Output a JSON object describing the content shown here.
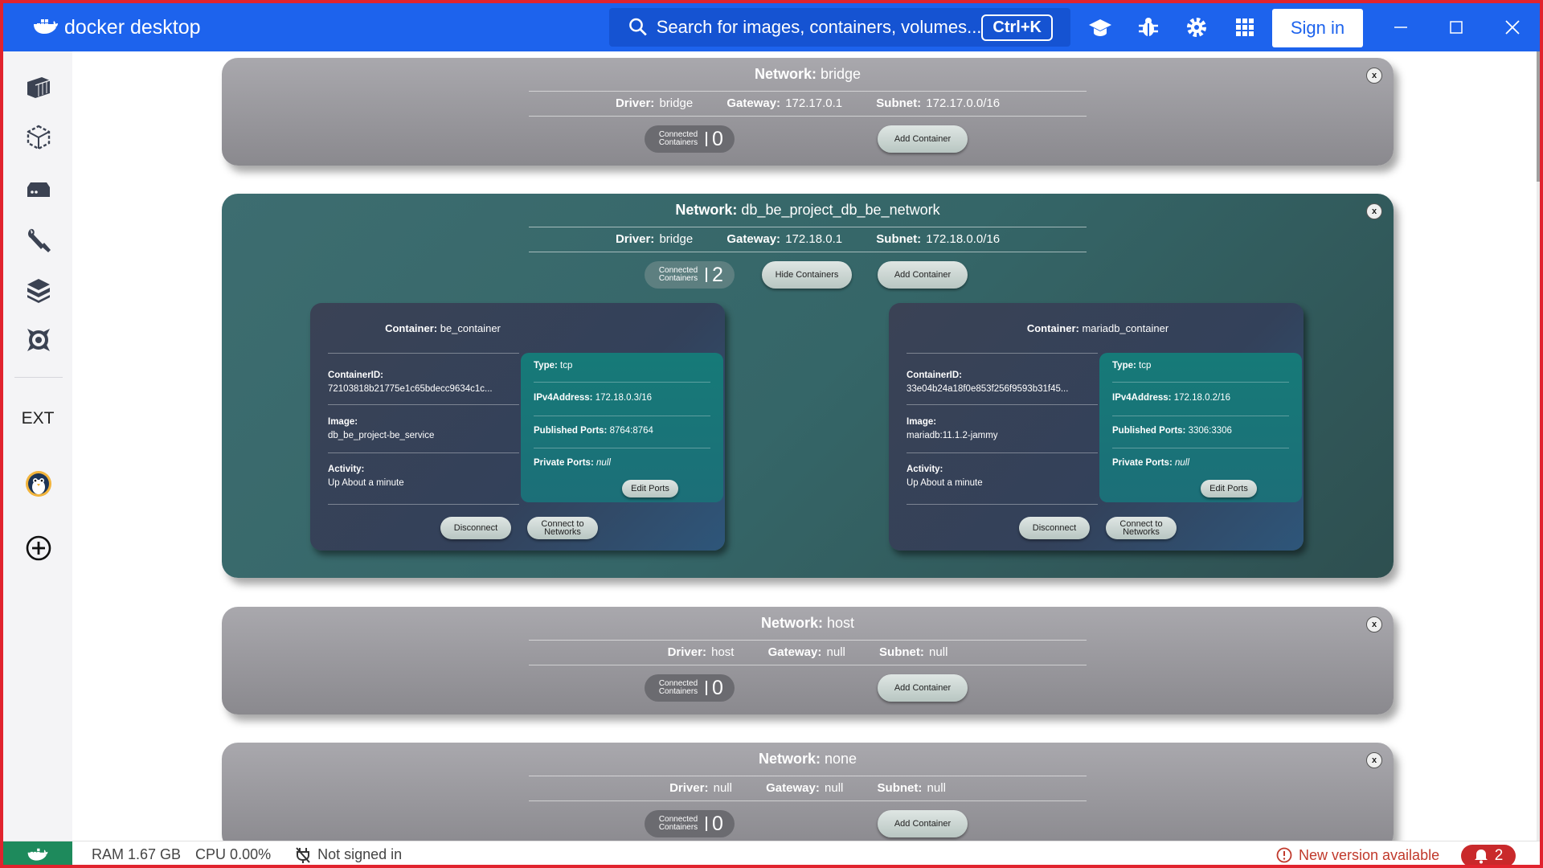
{
  "app": {
    "logo_text": "docker desktop",
    "sign_in_label": "Sign in"
  },
  "search": {
    "placeholder": "Search for images, containers, volumes...",
    "shortcut": "Ctrl+K"
  },
  "sidebar": {
    "ext_label": "EXT",
    "icons": [
      "containers-icon",
      "images-icon",
      "volumes-icon",
      "dev-tools-icon",
      "builds-icon",
      "scout-icon",
      "extension-avatar-icon",
      "add-extension-icon"
    ]
  },
  "networks": [
    {
      "name": "bridge",
      "driver": "bridge",
      "gateway": "172.17.0.1",
      "subnet": "172.17.0.0/16",
      "connected_count": "0"
    },
    {
      "name": "db_be_project_db_be_network",
      "driver": "bridge",
      "gateway": "172.18.0.1",
      "subnet": "172.18.0.0/16",
      "connected_count": "2",
      "hide_label": "Hide Containers",
      "containers": [
        {
          "name": "be_container",
          "container_id": "72103818b21775e1c65bdecc9634c1c...",
          "image": "db_be_project-be_service",
          "activity": "Up About a minute",
          "type": "tcp",
          "ipv4": "172.18.0.3/16",
          "published_ports": "8764:8764",
          "private_ports": "null"
        },
        {
          "name": "mariadb_container",
          "container_id": "33e04b24a18f0e853f256f9593b31f45...",
          "image": "mariadb:11.1.2-jammy",
          "activity": "Up About a minute",
          "type": "tcp",
          "ipv4": "172.18.0.2/16",
          "published_ports": "3306:3306",
          "private_ports": "null"
        }
      ]
    },
    {
      "name": "host",
      "driver": "host",
      "gateway": "null",
      "subnet": "null",
      "connected_count": "0"
    },
    {
      "name": "none",
      "driver": "null",
      "gateway": "null",
      "subnet": "null",
      "connected_count": "0"
    }
  ],
  "labels": {
    "network": "Network:",
    "driver": "Driver:",
    "gateway": "Gateway:",
    "subnet": "Subnet:",
    "connected_line1": "Connected",
    "connected_line2": "Containers",
    "add_container": "Add Container",
    "container": "Container:",
    "container_id": "ContainerID:",
    "image": "Image:",
    "activity": "Activity:",
    "type": "Type:",
    "ipv4": "IPv4Address:",
    "published_ports": "Published Ports:",
    "private_ports": "Private Ports:",
    "edit_ports": "Edit Ports",
    "disconnect": "Disconnect",
    "connect_line1": "Connect to",
    "connect_line2": "Networks",
    "close": "x"
  },
  "status": {
    "ram": "RAM 1.67 GB",
    "cpu": "CPU 0.00%",
    "signed": "Not signed in",
    "new_version": "New version available",
    "notifications": "2"
  },
  "colors": {
    "brand": "#1d63ed",
    "status_green": "#1e8a5c",
    "alert_red": "#c9292b"
  }
}
